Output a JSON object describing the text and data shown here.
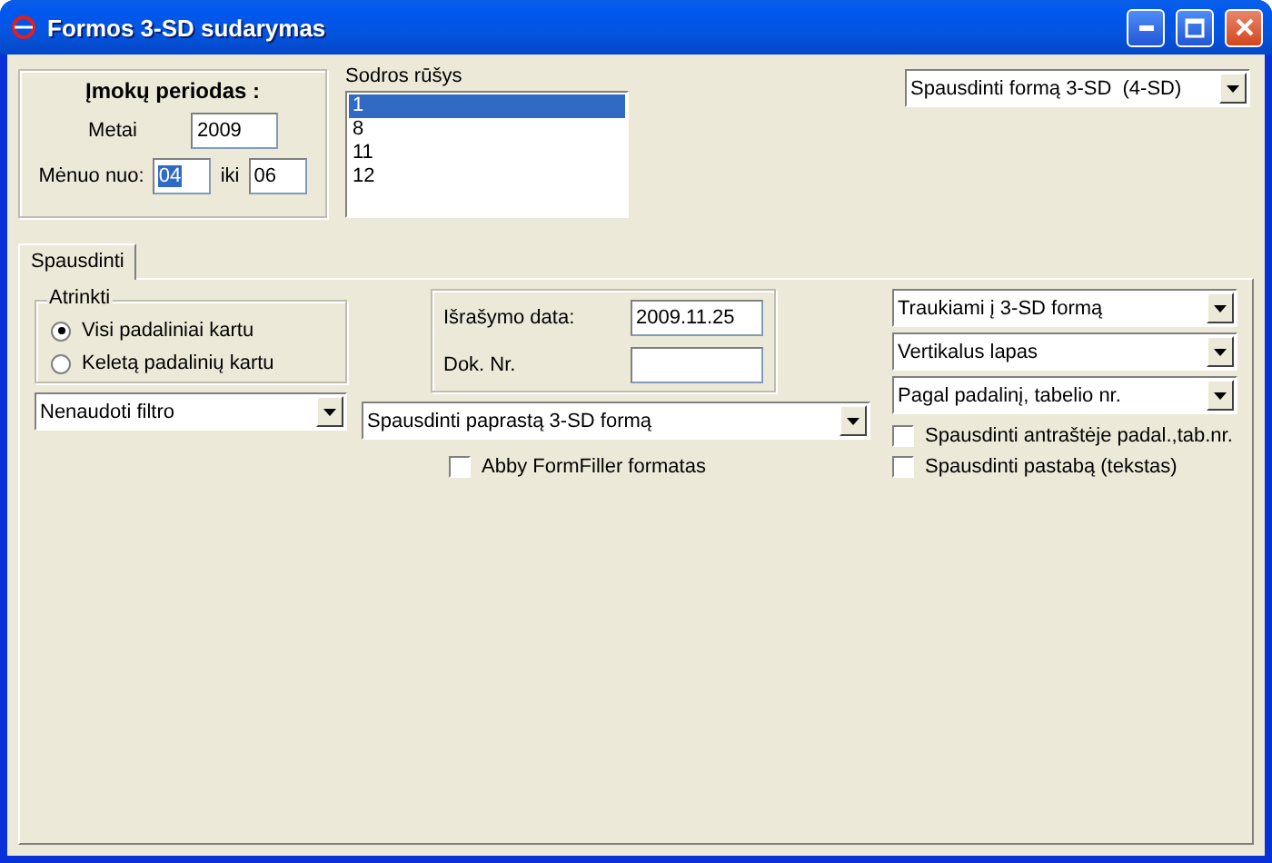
{
  "window": {
    "title": "Formos 3-SD sudarymas"
  },
  "period": {
    "title": "Įmokų periodas :",
    "year_label": "Metai",
    "year": "2009",
    "month_label": "Mėnuo nuo:",
    "month_from": "04",
    "month_from_highlighted": true,
    "to_label": "iki",
    "month_to": "06"
  },
  "insurance_types": {
    "label": "Sodros rūšys",
    "items": [
      {
        "text": "1",
        "selected": true
      },
      {
        "text": "8",
        "selected": false
      },
      {
        "text": "11",
        "selected": false
      },
      {
        "text": "12",
        "selected": false
      }
    ]
  },
  "print_form_combo": "Spausdinti formą 3-SD  (4-SD)",
  "tabs": [
    {
      "label": "Spausdinti",
      "selected": true
    }
  ],
  "select_group": {
    "title": "Atrinkti",
    "options": [
      {
        "label": "Visi padaliniai kartu",
        "selected": true
      },
      {
        "label": "Keletą padalinių kartu",
        "selected": false
      }
    ]
  },
  "filter_combo": "Nenaudoti filtro",
  "issue": {
    "date_label": "Išrašymo data:",
    "date": "2009.11.25",
    "doc_label": "Dok. Nr."
  },
  "form_combo": "Spausdinti paprastą 3-SD formą",
  "abby": {
    "label": "Abby FormFiller formatas",
    "checked": false
  },
  "right_combos": [
    "Traukiami į 3-SD formą",
    "Vertikalus lapas",
    "Pagal padalinį, tabelio nr."
  ],
  "right_checks": [
    {
      "label": "Spausdinti antraštėje padal.,tab.nr.",
      "checked": false
    },
    {
      "label": "Spausdinti pastabą (tekstas)",
      "checked": false
    }
  ]
}
